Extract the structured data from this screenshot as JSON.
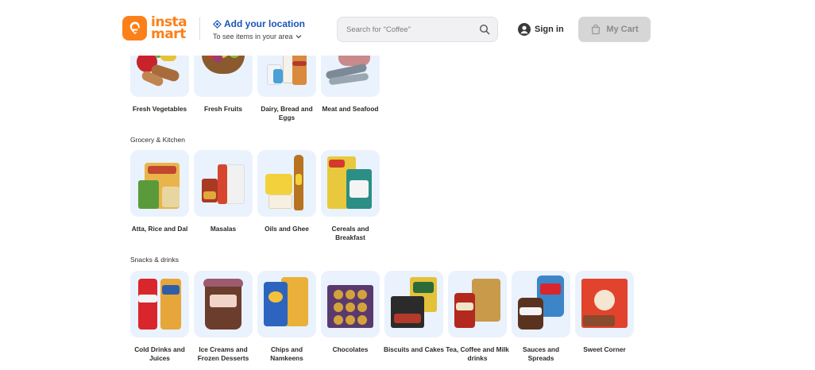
{
  "header": {
    "logo_line1": "insta",
    "logo_line2": "mart",
    "location_title": "Add your location",
    "location_subtitle": "To see items in your area",
    "search_placeholder": "Search for \"Coffee\"",
    "sign_in": "Sign in",
    "cart": "My Cart"
  },
  "colors": {
    "brand": "#fc8019",
    "link_blue": "#1b55b8",
    "tile_bg": "#e9f2fd",
    "cart_bg": "#d6d6d6"
  },
  "sections": [
    {
      "title": "",
      "items": [
        {
          "label": "Fresh Vegetables",
          "icon": "vegetables-image"
        },
        {
          "label": "Fresh Fruits",
          "icon": "fruits-image"
        },
        {
          "label": "Dairy, Bread and Eggs",
          "icon": "dairy-image"
        },
        {
          "label": "Meat and Seafood",
          "icon": "meat-image"
        }
      ]
    },
    {
      "title": "Grocery & Kitchen",
      "items": [
        {
          "label": "Atta, Rice and Dal",
          "icon": "atta-image"
        },
        {
          "label": "Masalas",
          "icon": "masalas-image"
        },
        {
          "label": "Oils and Ghee",
          "icon": "oils-image"
        },
        {
          "label": "Cereals and Breakfast",
          "icon": "cereals-image"
        }
      ]
    },
    {
      "title": "Snacks & drinks",
      "items": [
        {
          "label": "Cold Drinks and Juices",
          "icon": "cold-drinks-image"
        },
        {
          "label": "Ice Creams and Frozen Desserts",
          "icon": "ice-cream-image"
        },
        {
          "label": "Chips and Namkeens",
          "icon": "chips-image"
        },
        {
          "label": "Chocolates",
          "icon": "chocolates-image"
        },
        {
          "label": "Biscuits and Cakes",
          "icon": "biscuits-image"
        },
        {
          "label": "Tea, Coffee and Milk drinks",
          "icon": "tea-coffee-image"
        },
        {
          "label": "Sauces and Spreads",
          "icon": "sauces-image"
        },
        {
          "label": "Sweet Corner",
          "icon": "sweets-image"
        }
      ]
    }
  ]
}
